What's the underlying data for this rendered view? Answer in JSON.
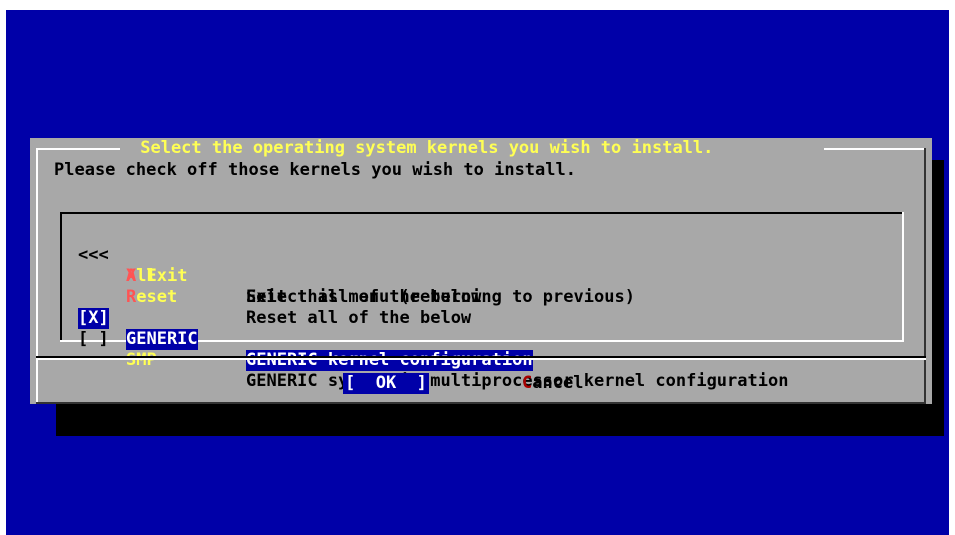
{
  "dialog": {
    "title": " Select the operating system kernels you wish to install. ",
    "prompt": "Please check off those kernels you wish to install."
  },
  "menu": {
    "exit": {
      "mark": "<<< ",
      "hot": "X",
      "name": " Exit",
      "desc": "Exit this menu (returning to previous)"
    },
    "all": {
      "hot": "A",
      "name": "ll",
      "desc": "Select all of the below"
    },
    "reset": {
      "hot": "R",
      "name": "eset",
      "desc": "Reset all of the below"
    },
    "items": [
      {
        "checkbox": "[X]",
        "checked": true,
        "selected": true,
        "name": "GENERIC",
        "desc": "GENERIC kernel configuration"
      },
      {
        "checkbox": "[ ]",
        "checked": false,
        "selected": false,
        "name": "SMP",
        "desc": "GENERIC symmetric multiprocessor kernel configuration"
      }
    ]
  },
  "buttons": {
    "ok_label": "[  OK  ]",
    "cancel_hot": "C",
    "cancel_rest": "ancel"
  },
  "colors": {
    "background": "#0000a8",
    "dialog": "#a8a8a8",
    "title": "#ffff54",
    "hotkey": "#ff5454",
    "selection": "#0000a8"
  }
}
